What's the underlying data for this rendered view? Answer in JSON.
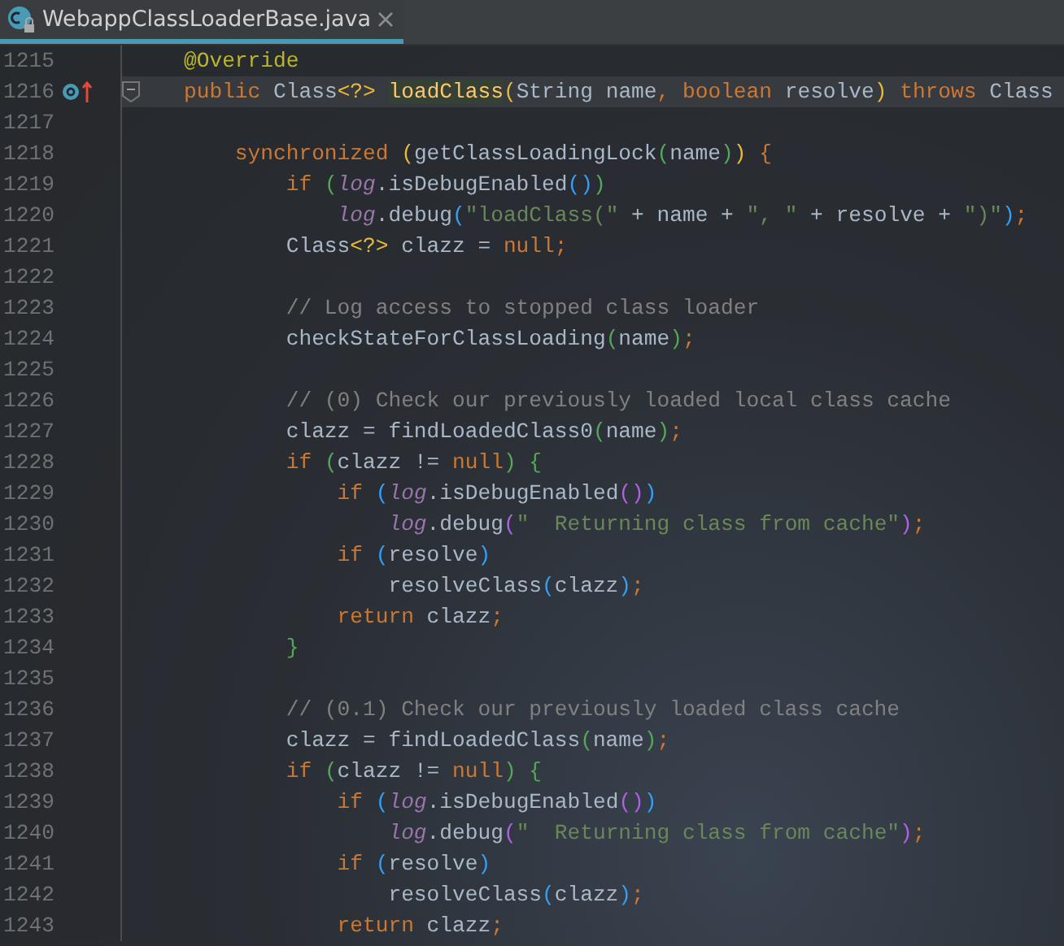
{
  "tab": {
    "title": "WebappClassLoaderBase.java",
    "selected": true
  },
  "lines": [
    {
      "number": "1215",
      "current": false,
      "foldable": false,
      "overrides": false,
      "code": [
        {
          "text": "@Override",
          "kind": "annotation"
        }
      ]
    },
    {
      "number": "1216",
      "current": true,
      "foldable": true,
      "overrides": true,
      "code": [
        {
          "text": "public ",
          "kind": "keyword"
        },
        {
          "text": "Class",
          "kind": "plain"
        },
        {
          "text": "<?> ",
          "kind": "bracket",
          "color": "#e8ba36"
        },
        {
          "text": "loadClass",
          "kind": "declaration"
        },
        {
          "text": "(",
          "kind": "bracket",
          "color": "#e8ba36"
        },
        {
          "text": "String name",
          "kind": "plain"
        },
        {
          "text": ", ",
          "kind": "keyword"
        },
        {
          "text": "boolean ",
          "kind": "keyword"
        },
        {
          "text": "resolve",
          "kind": "plain"
        },
        {
          "text": ")",
          "kind": "bracket",
          "color": "#e8ba36"
        },
        {
          "text": " throws ",
          "kind": "keyword"
        },
        {
          "text": "Class",
          "kind": "plain"
        }
      ]
    },
    {
      "number": "1217",
      "current": false,
      "foldable": false,
      "overrides": false
    },
    {
      "number": "1218",
      "current": false,
      "foldable": false,
      "overrides": false,
      "code": [
        {
          "text": "    synchronized ",
          "kind": "keyword"
        },
        {
          "text": "(",
          "kind": "bracket",
          "color": "#e8ba36"
        },
        {
          "text": "getClassLoadingLock",
          "kind": "plain"
        },
        {
          "text": "(",
          "kind": "bracket",
          "color": "#54a857"
        },
        {
          "text": "name",
          "kind": "plain"
        },
        {
          "text": ")",
          "kind": "bracket",
          "color": "#54a857"
        },
        {
          "text": ")",
          "kind": "bracket",
          "color": "#e8ba36"
        },
        {
          "text": " {",
          "kind": "keyword"
        }
      ]
    },
    {
      "number": "1219",
      "current": false,
      "foldable": false,
      "overrides": false,
      "code": [
        {
          "text": "        if ",
          "kind": "keyword"
        },
        {
          "text": "(",
          "kind": "bracket",
          "color": "#54a857"
        },
        {
          "text": "log",
          "kind": "field"
        },
        {
          "text": ".isDebugEnabled",
          "kind": "plain"
        },
        {
          "text": "()",
          "kind": "bracket",
          "color": "#359ff4"
        },
        {
          "text": ")",
          "kind": "bracket",
          "color": "#54a857"
        }
      ]
    },
    {
      "number": "1220",
      "current": false,
      "foldable": false,
      "overrides": false,
      "code": [
        {
          "text": "            log",
          "kind": "field"
        },
        {
          "text": ".debug",
          "kind": "plain"
        },
        {
          "text": "(",
          "kind": "bracket",
          "color": "#359ff4"
        },
        {
          "text": "\"loadClass(\"",
          "kind": "string"
        },
        {
          "text": " + name + ",
          "kind": "plain"
        },
        {
          "text": "\", \"",
          "kind": "string"
        },
        {
          "text": " + resolve + ",
          "kind": "plain"
        },
        {
          "text": "\")\"",
          "kind": "string"
        },
        {
          "text": ")",
          "kind": "bracket",
          "color": "#359ff4"
        },
        {
          "text": ";",
          "kind": "keyword"
        }
      ]
    },
    {
      "number": "1221",
      "current": false,
      "foldable": false,
      "overrides": false,
      "code": [
        {
          "text": "        Class",
          "kind": "plain"
        },
        {
          "text": "<?>",
          "kind": "bracket",
          "color": "#e8ba36"
        },
        {
          "text": " clazz = ",
          "kind": "plain"
        },
        {
          "text": "null;",
          "kind": "keyword"
        }
      ]
    },
    {
      "number": "1222",
      "current": false,
      "foldable": false,
      "overrides": false
    },
    {
      "number": "1223",
      "current": false,
      "foldable": false,
      "overrides": false,
      "code": [
        {
          "text": "        // Log access to stopped class loader",
          "kind": "comment"
        }
      ]
    },
    {
      "number": "1224",
      "current": false,
      "foldable": false,
      "overrides": false,
      "code": [
        {
          "text": "        checkStateForClassLoading",
          "kind": "plain"
        },
        {
          "text": "(",
          "kind": "bracket",
          "color": "#54a857"
        },
        {
          "text": "name",
          "kind": "plain"
        },
        {
          "text": ")",
          "kind": "bracket",
          "color": "#54a857"
        },
        {
          "text": ";",
          "kind": "keyword"
        }
      ]
    },
    {
      "number": "1225",
      "current": false,
      "foldable": false,
      "overrides": false
    },
    {
      "number": "1226",
      "current": false,
      "foldable": false,
      "overrides": false,
      "code": [
        {
          "text": "        // (0) Check our previously loaded local class cache",
          "kind": "comment"
        }
      ]
    },
    {
      "number": "1227",
      "current": false,
      "foldable": false,
      "overrides": false,
      "code": [
        {
          "text": "        clazz = findLoadedClass0",
          "kind": "plain"
        },
        {
          "text": "(",
          "kind": "bracket",
          "color": "#54a857"
        },
        {
          "text": "name",
          "kind": "plain"
        },
        {
          "text": ")",
          "kind": "bracket",
          "color": "#54a857"
        },
        {
          "text": ";",
          "kind": "keyword"
        }
      ]
    },
    {
      "number": "1228",
      "current": false,
      "foldable": false,
      "overrides": false,
      "code": [
        {
          "text": "        if ",
          "kind": "keyword"
        },
        {
          "text": "(",
          "kind": "bracket",
          "color": "#54a857"
        },
        {
          "text": "clazz != ",
          "kind": "plain"
        },
        {
          "text": "null",
          "kind": "keyword"
        },
        {
          "text": ") {",
          "kind": "bracket",
          "color": "#54a857"
        }
      ]
    },
    {
      "number": "1229",
      "current": false,
      "foldable": false,
      "overrides": false,
      "code": [
        {
          "text": "            if ",
          "kind": "keyword"
        },
        {
          "text": "(",
          "kind": "bracket",
          "color": "#359ff4"
        },
        {
          "text": "log",
          "kind": "field"
        },
        {
          "text": ".isDebugEnabled",
          "kind": "plain"
        },
        {
          "text": "()",
          "kind": "bracket",
          "color": "#b160e5"
        },
        {
          "text": ")",
          "kind": "bracket",
          "color": "#359ff4"
        }
      ]
    },
    {
      "number": "1230",
      "current": false,
      "foldable": false,
      "overrides": false,
      "code": [
        {
          "text": "                log",
          "kind": "field"
        },
        {
          "text": ".debug",
          "kind": "plain"
        },
        {
          "text": "(",
          "kind": "bracket",
          "color": "#b160e5"
        },
        {
          "text": "\"  Returning class from cache\"",
          "kind": "string"
        },
        {
          "text": ")",
          "kind": "bracket",
          "color": "#b160e5"
        },
        {
          "text": ";",
          "kind": "keyword"
        }
      ]
    },
    {
      "number": "1231",
      "current": false,
      "foldable": false,
      "overrides": false,
      "code": [
        {
          "text": "            if ",
          "kind": "keyword"
        },
        {
          "text": "(",
          "kind": "bracket",
          "color": "#359ff4"
        },
        {
          "text": "resolve",
          "kind": "plain"
        },
        {
          "text": ")",
          "kind": "bracket",
          "color": "#359ff4"
        }
      ]
    },
    {
      "number": "1232",
      "current": false,
      "foldable": false,
      "overrides": false,
      "code": [
        {
          "text": "                resolveClass",
          "kind": "plain"
        },
        {
          "text": "(",
          "kind": "bracket",
          "color": "#359ff4"
        },
        {
          "text": "clazz",
          "kind": "plain"
        },
        {
          "text": ")",
          "kind": "bracket",
          "color": "#359ff4"
        },
        {
          "text": ";",
          "kind": "keyword"
        }
      ]
    },
    {
      "number": "1233",
      "current": false,
      "foldable": false,
      "overrides": false,
      "code": [
        {
          "text": "            return ",
          "kind": "keyword"
        },
        {
          "text": "clazz",
          "kind": "plain"
        },
        {
          "text": ";",
          "kind": "keyword"
        }
      ]
    },
    {
      "number": "1234",
      "current": false,
      "foldable": false,
      "overrides": false,
      "code": [
        {
          "text": "        }",
          "kind": "bracket",
          "color": "#54a857"
        }
      ]
    },
    {
      "number": "1235",
      "current": false,
      "foldable": false,
      "overrides": false
    },
    {
      "number": "1236",
      "current": false,
      "foldable": false,
      "overrides": false,
      "code": [
        {
          "text": "        // (0.1) Check our previously loaded class cache",
          "kind": "comment"
        }
      ]
    },
    {
      "number": "1237",
      "current": false,
      "foldable": false,
      "overrides": false,
      "code": [
        {
          "text": "        clazz = findLoadedClass",
          "kind": "plain"
        },
        {
          "text": "(",
          "kind": "bracket",
          "color": "#54a857"
        },
        {
          "text": "name",
          "kind": "plain"
        },
        {
          "text": ")",
          "kind": "bracket",
          "color": "#54a857"
        },
        {
          "text": ";",
          "kind": "keyword"
        }
      ]
    },
    {
      "number": "1238",
      "current": false,
      "foldable": false,
      "overrides": false,
      "code": [
        {
          "text": "        if ",
          "kind": "keyword"
        },
        {
          "text": "(",
          "kind": "bracket",
          "color": "#54a857"
        },
        {
          "text": "clazz != ",
          "kind": "plain"
        },
        {
          "text": "null",
          "kind": "keyword"
        },
        {
          "text": ") {",
          "kind": "bracket",
          "color": "#54a857"
        }
      ]
    },
    {
      "number": "1239",
      "current": false,
      "foldable": false,
      "overrides": false,
      "code": [
        {
          "text": "            if ",
          "kind": "keyword"
        },
        {
          "text": "(",
          "kind": "bracket",
          "color": "#359ff4"
        },
        {
          "text": "log",
          "kind": "field"
        },
        {
          "text": ".isDebugEnabled",
          "kind": "plain"
        },
        {
          "text": "()",
          "kind": "bracket",
          "color": "#b160e5"
        },
        {
          "text": ")",
          "kind": "bracket",
          "color": "#359ff4"
        }
      ]
    },
    {
      "number": "1240",
      "current": false,
      "foldable": false,
      "overrides": false,
      "code": [
        {
          "text": "                log",
          "kind": "field"
        },
        {
          "text": ".debug",
          "kind": "plain"
        },
        {
          "text": "(",
          "kind": "bracket",
          "color": "#b160e5"
        },
        {
          "text": "\"  Returning class from cache\"",
          "kind": "string"
        },
        {
          "text": ")",
          "kind": "bracket",
          "color": "#b160e5"
        },
        {
          "text": ";",
          "kind": "keyword"
        }
      ]
    },
    {
      "number": "1241",
      "current": false,
      "foldable": false,
      "overrides": false,
      "code": [
        {
          "text": "            if ",
          "kind": "keyword"
        },
        {
          "text": "(",
          "kind": "bracket",
          "color": "#359ff4"
        },
        {
          "text": "resolve",
          "kind": "plain"
        },
        {
          "text": ")",
          "kind": "bracket",
          "color": "#359ff4"
        }
      ]
    },
    {
      "number": "1242",
      "current": false,
      "foldable": false,
      "overrides": false,
      "code": [
        {
          "text": "                resolveClass",
          "kind": "plain"
        },
        {
          "text": "(",
          "kind": "bracket",
          "color": "#359ff4"
        },
        {
          "text": "clazz",
          "kind": "plain"
        },
        {
          "text": ")",
          "kind": "bracket",
          "color": "#359ff4"
        },
        {
          "text": ";",
          "kind": "keyword"
        }
      ]
    },
    {
      "number": "1243",
      "current": false,
      "foldable": false,
      "overrides": false,
      "code": [
        {
          "text": "            return ",
          "kind": "keyword"
        },
        {
          "text": "clazz",
          "kind": "plain"
        },
        {
          "text": ";",
          "kind": "keyword"
        }
      ]
    }
  ]
}
